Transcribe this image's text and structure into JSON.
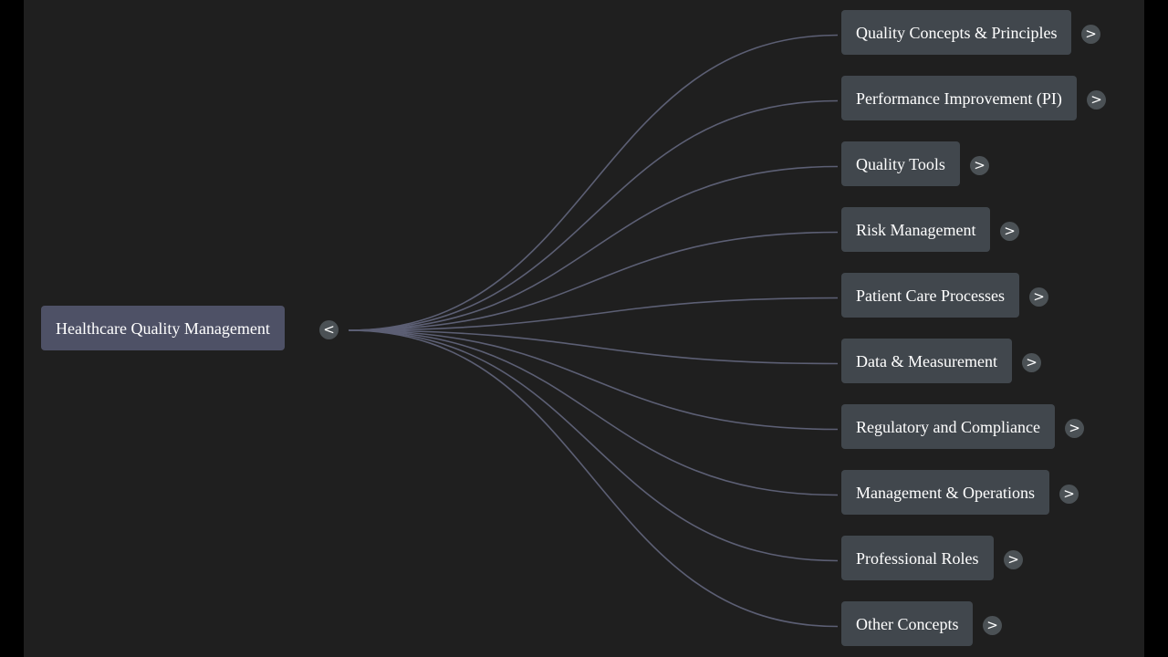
{
  "mindmap": {
    "root": {
      "label": "Healthcare Quality Management",
      "toggle_symbol": "<"
    },
    "children": [
      {
        "label": "Quality Concepts & Principles",
        "toggle_symbol": ">"
      },
      {
        "label": "Performance Improvement (PI)",
        "toggle_symbol": ">"
      },
      {
        "label": "Quality Tools",
        "toggle_symbol": ">"
      },
      {
        "label": "Risk Management",
        "toggle_symbol": ">"
      },
      {
        "label": "Patient Care Processes",
        "toggle_symbol": ">"
      },
      {
        "label": "Data & Measurement",
        "toggle_symbol": ">"
      },
      {
        "label": "Regulatory and Compliance",
        "toggle_symbol": ">"
      },
      {
        "label": "Management & Operations",
        "toggle_symbol": ">"
      },
      {
        "label": "Professional Roles",
        "toggle_symbol": ">"
      },
      {
        "label": "Other Concepts",
        "toggle_symbol": ">"
      }
    ]
  },
  "colors": {
    "background": "#1f1f1f",
    "root_node": "#4e5166",
    "child_node": "#41474d",
    "connector": "#5c5f74",
    "toggle": "#4b5155",
    "text": "#ffffff"
  }
}
